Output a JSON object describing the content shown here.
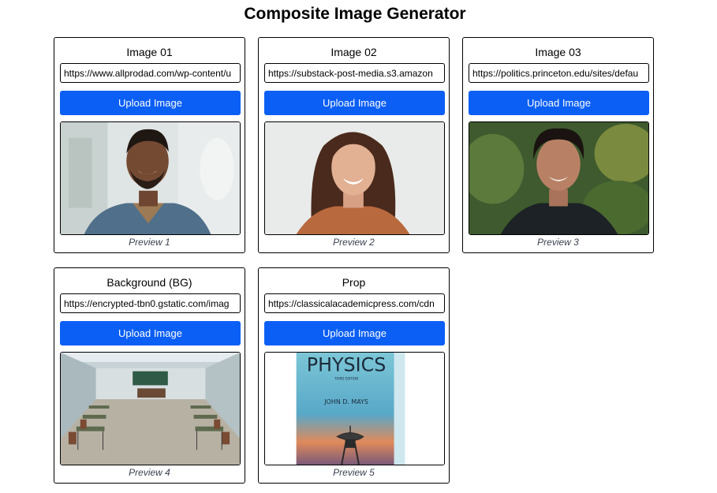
{
  "page": {
    "title": "Composite Image Generator"
  },
  "cards": [
    {
      "title": "Image 01",
      "url": "https://www.allprodad.com/wp-content/u",
      "button_label": "Upload Image",
      "caption": "Preview 1",
      "preview": "smiling-man-portrait"
    },
    {
      "title": "Image 02",
      "url": "https://substack-post-media.s3.amazon",
      "button_label": "Upload Image",
      "caption": "Preview 2",
      "preview": "smiling-woman-portrait"
    },
    {
      "title": "Image 03",
      "url": "https://politics.princeton.edu/sites/defau",
      "button_label": "Upload Image",
      "caption": "Preview 3",
      "preview": "young-man-portrait"
    },
    {
      "title": "Background (BG)",
      "url": "https://encrypted-tbn0.gstatic.com/imag",
      "button_label": "Upload Image",
      "caption": "Preview 4",
      "preview": "classroom-background"
    },
    {
      "title": "Prop",
      "url": "https://classicalacademicpress.com/cdn",
      "button_label": "Upload Image",
      "caption": "Preview 5",
      "preview": "physics-book-cover",
      "prop_text": {
        "title": "PHYSICS",
        "edition": "THIRD EDITION",
        "author": "JOHN D. MAYS"
      }
    }
  ],
  "colors": {
    "button": "#0b5ff5",
    "caption": "#3b4250"
  }
}
